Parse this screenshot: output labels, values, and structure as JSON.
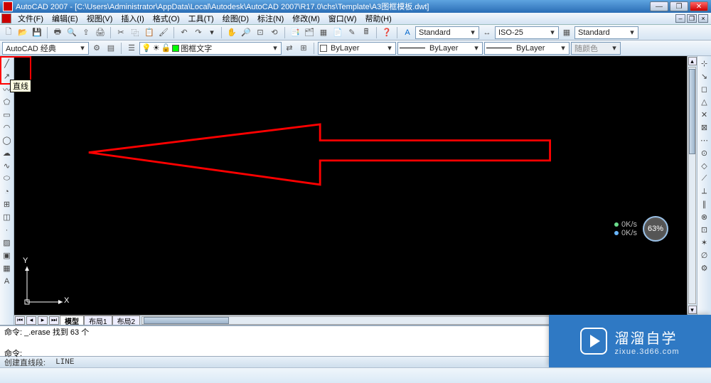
{
  "title": "AutoCAD 2007 - [C:\\Users\\Administrator\\AppData\\Local\\Autodesk\\AutoCAD 2007\\R17.0\\chs\\Template\\A3图框模板.dwt]",
  "menu": [
    "文件(F)",
    "编辑(E)",
    "视图(V)",
    "插入(I)",
    "格式(O)",
    "工具(T)",
    "绘图(D)",
    "标注(N)",
    "修改(M)",
    "窗口(W)",
    "帮助(H)"
  ],
  "toolbar1": {
    "style1": "Standard",
    "style2": "ISO-25",
    "style3": "Standard"
  },
  "toolbar2": {
    "workspace": "AutoCAD 经典",
    "layer": "图框文字",
    "linetype": "ByLayer",
    "lineweight": "ByLayer",
    "plotstyle": "ByLayer",
    "color_label": "随颜色"
  },
  "left_tools_alt": [
    "直线",
    "构造线",
    "多段线",
    "多边形",
    "矩形",
    "圆弧",
    "圆",
    "云线",
    "样条",
    "椭圆",
    "椭圆弧",
    "插入块",
    "创建块",
    "点",
    "图案填充",
    "面域",
    "表格",
    "文字"
  ],
  "right_tools_alt": [
    "临时追踪",
    "自",
    "端点",
    "中点",
    "交点",
    "外观交点",
    "延长线",
    "圆心",
    "象限点",
    "切点",
    "垂足",
    "平行线",
    "节点",
    "插入点",
    "最近点",
    "无",
    "对象捕捉设置"
  ],
  "tooltip": "直线",
  "tabs": [
    "模型",
    "布局1",
    "布局2"
  ],
  "active_tab": 0,
  "cmd": {
    "line1": "命令: _.erase 找到 63 个",
    "line2": "命令:"
  },
  "status": {
    "left": "创建直线段:",
    "hint": "LINE"
  },
  "ucs": {
    "x": "X",
    "y": "Y"
  },
  "perf": {
    "up": "0K/s",
    "down": "0K/s",
    "pct": "63%"
  },
  "watermark": {
    "big": "溜溜自学",
    "small": "zixue.3d66.com"
  }
}
